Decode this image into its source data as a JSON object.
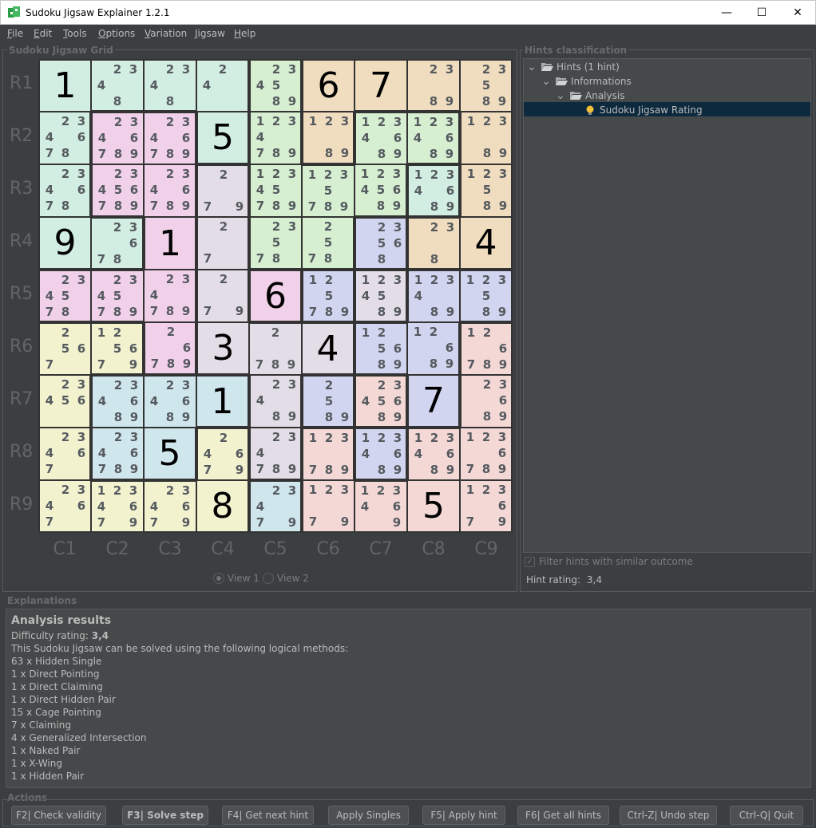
{
  "window": {
    "title": "Sudoku Jigsaw Explainer 1.2.1",
    "minimize": "—",
    "maximize": "☐",
    "close": "✕"
  },
  "menu": [
    "File",
    "Edit",
    "Tools",
    "Options",
    "Variation",
    "Jigsaw",
    "Help"
  ],
  "grid_panel": {
    "title": "Sudoku Jigsaw Grid",
    "row_labels": [
      "R1",
      "R2",
      "R3",
      "R4",
      "R5",
      "R6",
      "R7",
      "R8",
      "R9"
    ],
    "col_labels": [
      "C1",
      "C2",
      "C3",
      "C4",
      "C5",
      "C6",
      "C7",
      "C8",
      "C9"
    ],
    "view1": "View 1",
    "view2": "View 2"
  },
  "grid": {
    "colors": {
      "a": "#d2ede2",
      "b": "#f0dcbe",
      "c": "#d6efd1",
      "d": "#f1d0ea",
      "e": "#e2dde6",
      "f": "#d2d5ef",
      "g": "#f2f2cf",
      "h": "#d0e6ed",
      "i": "#f3d8d5"
    },
    "regions": [
      "aaaacbbbb",
      "addacbccb",
      "addecccab",
      "aadeccfbb",
      "dddedfeff",
      "ggdeeeffi",
      "ghhhefifi",
      "ghhgeifii",
      "gggghiiii"
    ],
    "cells": [
      [
        "1",
        "23 4 8",
        "23 4 8",
        "2 4",
        "23 45 89",
        "6",
        "7",
        "23 89",
        "23 5 89"
      ],
      [
        "23 46 78",
        "23 46 789",
        "23 46 789",
        "5",
        "123 4 789",
        "123 89",
        "123 46 89",
        "123 46 89",
        "123 89"
      ],
      [
        "23 46 78",
        "23 456 789",
        "23 46 789",
        "2 79",
        "123 45 789",
        "123 5 789",
        "123 456 89",
        "123 46 89",
        "123 5 89"
      ],
      [
        "9",
        "23 6 78",
        "1",
        "2 7",
        "23 5 78",
        "2 5 78",
        "23 56 8",
        "23 8",
        "4"
      ],
      [
        "23 45 78",
        "23 45 789",
        "23 4 789",
        "2 79",
        "6",
        "12 5 789",
        "123 45 89",
        "123 4 89",
        "123 5 89"
      ],
      [
        "2 56 7",
        "12 56 79",
        "2 6 789",
        "3",
        "2 789",
        "4",
        "12 56 89",
        "12 6 89",
        "12 6 789"
      ],
      [
        "23 456",
        "23 46 89",
        "23 46 89",
        "1",
        "23 4 89",
        "2 5 89",
        "23 456 89",
        "7",
        "23 6 89"
      ],
      [
        "23 46 7",
        "23 46 789",
        "5",
        "2 469 7",
        "23 4 789",
        "123 789",
        "123 46 89",
        "123 46 89",
        "123 6 789"
      ],
      [
        "23 46 7",
        "123 46 79",
        "23 46 79",
        "8",
        "23 4 79",
        "123 79",
        "123 46 9",
        "5",
        "123 6 79"
      ]
    ]
  },
  "hints_panel": {
    "title": "Hints classification",
    "tree": [
      {
        "label": "Hints (1 hint)",
        "level": 0,
        "icon": "folder-open-icon"
      },
      {
        "label": "Informations",
        "level": 1,
        "icon": "folder-open-icon"
      },
      {
        "label": "Analysis",
        "level": 2,
        "icon": "folder-open-icon"
      },
      {
        "label": "Sudoku Jigsaw Rating",
        "level": 3,
        "icon": "lightbulb-icon"
      }
    ],
    "filter_label": "Filter hints with similar outcome",
    "filter_checked": true,
    "rating_label": "Hint rating:",
    "rating_value": "3,4"
  },
  "explanations": {
    "title": "Explanations",
    "heading": "Analysis results",
    "difficulty_label": "Difficulty rating:",
    "difficulty_value": "3,4",
    "intro": "This Sudoku Jigsaw can be solved using the following logical methods:",
    "methods": [
      "63 x Hidden Single",
      "1 x Direct Pointing",
      "1 x Direct Claiming",
      "1 x Direct Hidden Pair",
      "15 x Cage Pointing",
      "7 x Claiming",
      "4 x Generalized Intersection",
      "1 x Naked Pair",
      "1 x X-Wing",
      "1 x Hidden Pair"
    ]
  },
  "actions": {
    "title": "Actions",
    "buttons": [
      "F2| Check validity",
      "F3| Solve step",
      "F4| Get next hint",
      "Apply Singles",
      "F5| Apply hint",
      "F6| Get all hints",
      "Ctrl-Z| Undo step",
      "Ctrl-Q| Quit"
    ]
  }
}
